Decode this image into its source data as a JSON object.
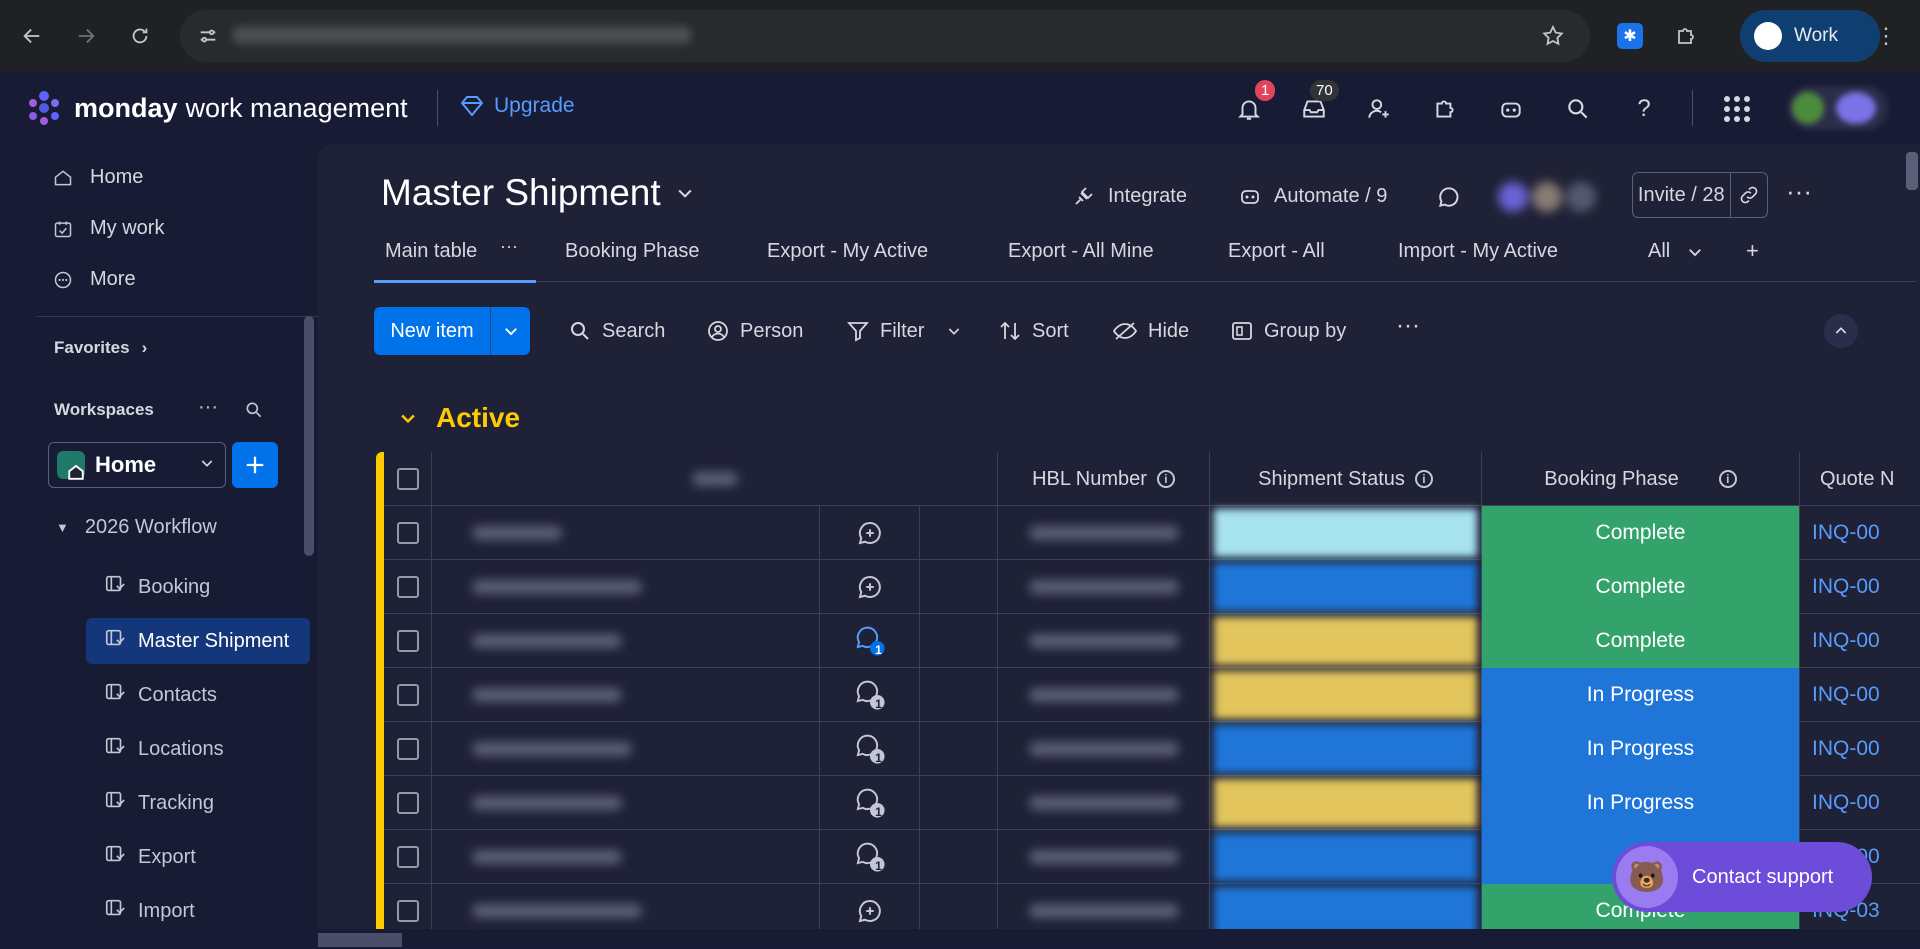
{
  "browser": {
    "profile_label": "Work",
    "icons": [
      "back-icon",
      "forward-icon",
      "reload-icon",
      "site-info-icon",
      "star-icon",
      "extension-icon",
      "puzzle-icon",
      "more-vert-icon"
    ]
  },
  "topbar": {
    "brand": "monday",
    "brand_suffix": "work management",
    "upgrade": "Upgrade",
    "notifications_badge": "1",
    "inbox_badge": "70",
    "accent": "#579bfc"
  },
  "sidebar": {
    "nav": [
      {
        "label": "Home",
        "icon": "home-icon"
      },
      {
        "label": "My work",
        "icon": "calendar-check-icon"
      },
      {
        "label": "More",
        "icon": "more-circle-icon"
      }
    ],
    "favorites": "Favorites",
    "workspaces": "Workspaces",
    "workspace_name": "Home",
    "folder": "2026 Workflow",
    "boards": [
      "Booking",
      "Master Shipment",
      "Contacts",
      "Locations",
      "Tracking",
      "Export",
      "Import"
    ],
    "selected_board": "Master Shipment"
  },
  "board": {
    "title": "Master Shipment",
    "integrate": "Integrate",
    "automate": "Automate / 9",
    "invite": "Invite / 28",
    "tabs": [
      "Main table",
      "Booking Phase",
      "Export - My Active",
      "Export - All Mine",
      "Export - All",
      "Import - My Active",
      "All"
    ],
    "toolbar": {
      "new_item": "New item",
      "search": "Search",
      "person": "Person",
      "filter": "Filter",
      "sort": "Sort",
      "hide": "Hide",
      "group_by": "Group by"
    },
    "group_title": "Active",
    "group_color": "#ffcb00",
    "columns": [
      "HBL Number",
      "Shipment Status",
      "Booking Phase",
      "Quote N"
    ],
    "rows": [
      {
        "booking_phase": "Complete",
        "phase_color": "#33a36b",
        "status_color": "#a7e3ef",
        "quote": "INQ-00",
        "updates": "add",
        "update_count": ""
      },
      {
        "booking_phase": "Complete",
        "phase_color": "#33a36b",
        "status_color": "#1f76d8",
        "quote": "INQ-00",
        "updates": "add",
        "update_count": ""
      },
      {
        "booking_phase": "Complete",
        "phase_color": "#33a36b",
        "status_color": "#e2c55c",
        "quote": "INQ-00",
        "updates": "count-blue",
        "update_count": "1"
      },
      {
        "booking_phase": "In Progress",
        "phase_color": "#1f76d8",
        "status_color": "#e2c55c",
        "quote": "INQ-00",
        "updates": "count",
        "update_count": "1"
      },
      {
        "booking_phase": "In Progress",
        "phase_color": "#1f76d8",
        "status_color": "#1f76d8",
        "quote": "INQ-00",
        "updates": "count",
        "update_count": "1"
      },
      {
        "booking_phase": "In Progress",
        "phase_color": "#1f76d8",
        "status_color": "#e2c55c",
        "quote": "INQ-00",
        "updates": "count",
        "update_count": "1"
      },
      {
        "booking_phase": "In",
        "phase_color": "#1f76d8",
        "status_color": "#1f76d8",
        "quote": "INQ-00",
        "updates": "count",
        "update_count": "1"
      },
      {
        "booking_phase": "Complete",
        "phase_color": "#33a36b",
        "status_color": "#1f76d8",
        "quote": "INQ-03",
        "updates": "add",
        "update_count": ""
      }
    ]
  },
  "support": {
    "label": "Contact support"
  }
}
